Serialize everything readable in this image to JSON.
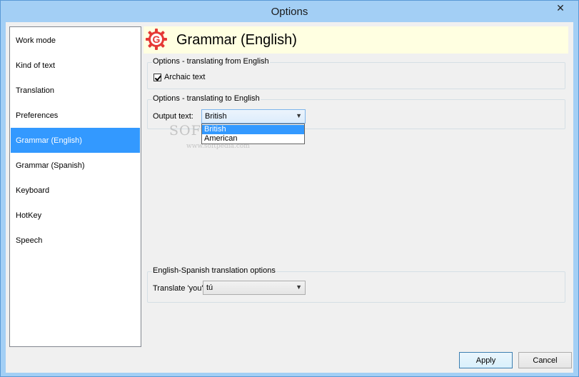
{
  "window": {
    "title": "Options",
    "close_glyph": "✕"
  },
  "nav": {
    "items": [
      {
        "label": "Work mode",
        "selected": false
      },
      {
        "label": "Kind of text",
        "selected": false
      },
      {
        "label": "Translation",
        "selected": false
      },
      {
        "label": "Preferences",
        "selected": false
      },
      {
        "label": "Grammar (English)",
        "selected": true
      },
      {
        "label": "Grammar (Spanish)",
        "selected": false
      },
      {
        "label": "Keyboard",
        "selected": false
      },
      {
        "label": "HotKey",
        "selected": false
      },
      {
        "label": "Speech",
        "selected": false
      }
    ]
  },
  "header": {
    "title": "Grammar (English)",
    "logo_letter": "G",
    "logo_color": "#e53935"
  },
  "from_english": {
    "legend": "Options - translating from English",
    "archaic_label": "Archaic text",
    "archaic_checked": true
  },
  "to_english": {
    "legend": "Options - translating to English",
    "output_label": "Output text:",
    "output_value": "British",
    "options": [
      "British",
      "American"
    ]
  },
  "en_es": {
    "legend": "English-Spanish translation options",
    "translate_label": "Translate 'you'",
    "translate_value": "tú"
  },
  "watermark": {
    "main": "SOFTPEDIA",
    "sub": "www.softpedia.com"
  },
  "buttons": {
    "apply": "Apply",
    "cancel": "Cancel"
  },
  "colors": {
    "selection": "#3399ff",
    "header_bg": "#ffffe1",
    "titlebar": "#a3cff5"
  }
}
